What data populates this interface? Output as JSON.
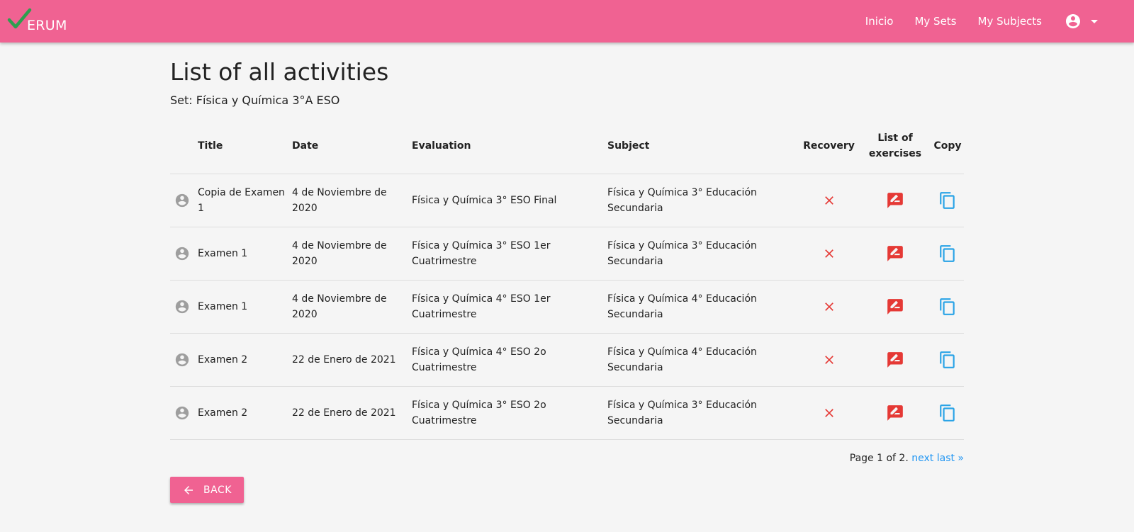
{
  "brand": {
    "logo_text": "ERUM",
    "check_color": "#2e9e4f"
  },
  "nav": {
    "links": [
      "Inicio",
      "My Sets",
      "My Subjects"
    ],
    "account_icon": "account-circle-icon",
    "dropdown_icon": "caret-down-icon"
  },
  "page": {
    "title": "List of all activities",
    "set_label": "Set: Física y Química 3°A ESO"
  },
  "table": {
    "headers": {
      "title": "Title",
      "date": "Date",
      "evaluation": "Evaluation",
      "subject": "Subject",
      "recovery": "Recovery",
      "exercises": "List of exercises",
      "copy": "Copy"
    },
    "rows": [
      {
        "title": "Copia de Examen 1",
        "date": "4 de Noviembre de 2020",
        "evaluation": "Física y Química 3° ESO Final",
        "subject": "Física y Química 3° Educación Secundaria",
        "recovery": false
      },
      {
        "title": "Examen 1",
        "date": "4 de Noviembre de 2020",
        "evaluation": "Física y Química 3° ESO 1er Cuatrimestre",
        "subject": "Física y Química 3° Educación Secundaria",
        "recovery": false
      },
      {
        "title": "Examen 1",
        "date": "4 de Noviembre de 2020",
        "evaluation": "Física y Química 4° ESO 1er Cuatrimestre",
        "subject": "Física y Química 4° Educación Secundaria",
        "recovery": false
      },
      {
        "title": "Examen 2",
        "date": "22 de Enero de 2021",
        "evaluation": "Física y Química 4° ESO 2o Cuatrimestre",
        "subject": "Física y Química 4° Educación Secundaria",
        "recovery": false
      },
      {
        "title": "Examen 2",
        "date": "22 de Enero de 2021",
        "evaluation": "Física y Química 3° ESO 2o Cuatrimestre",
        "subject": "Física y Química 3° Educación Secundaria",
        "recovery": false
      }
    ]
  },
  "pagination": {
    "text": "Page 1 of 2.",
    "next": "next",
    "last": "last »"
  },
  "back_button": {
    "label": "BACK"
  },
  "colors": {
    "primary": "#f06292",
    "recovery_x": "#e53935",
    "exercises_icon": "#e53935",
    "copy_icon": "#29a3e6",
    "link": "#2196f3"
  }
}
